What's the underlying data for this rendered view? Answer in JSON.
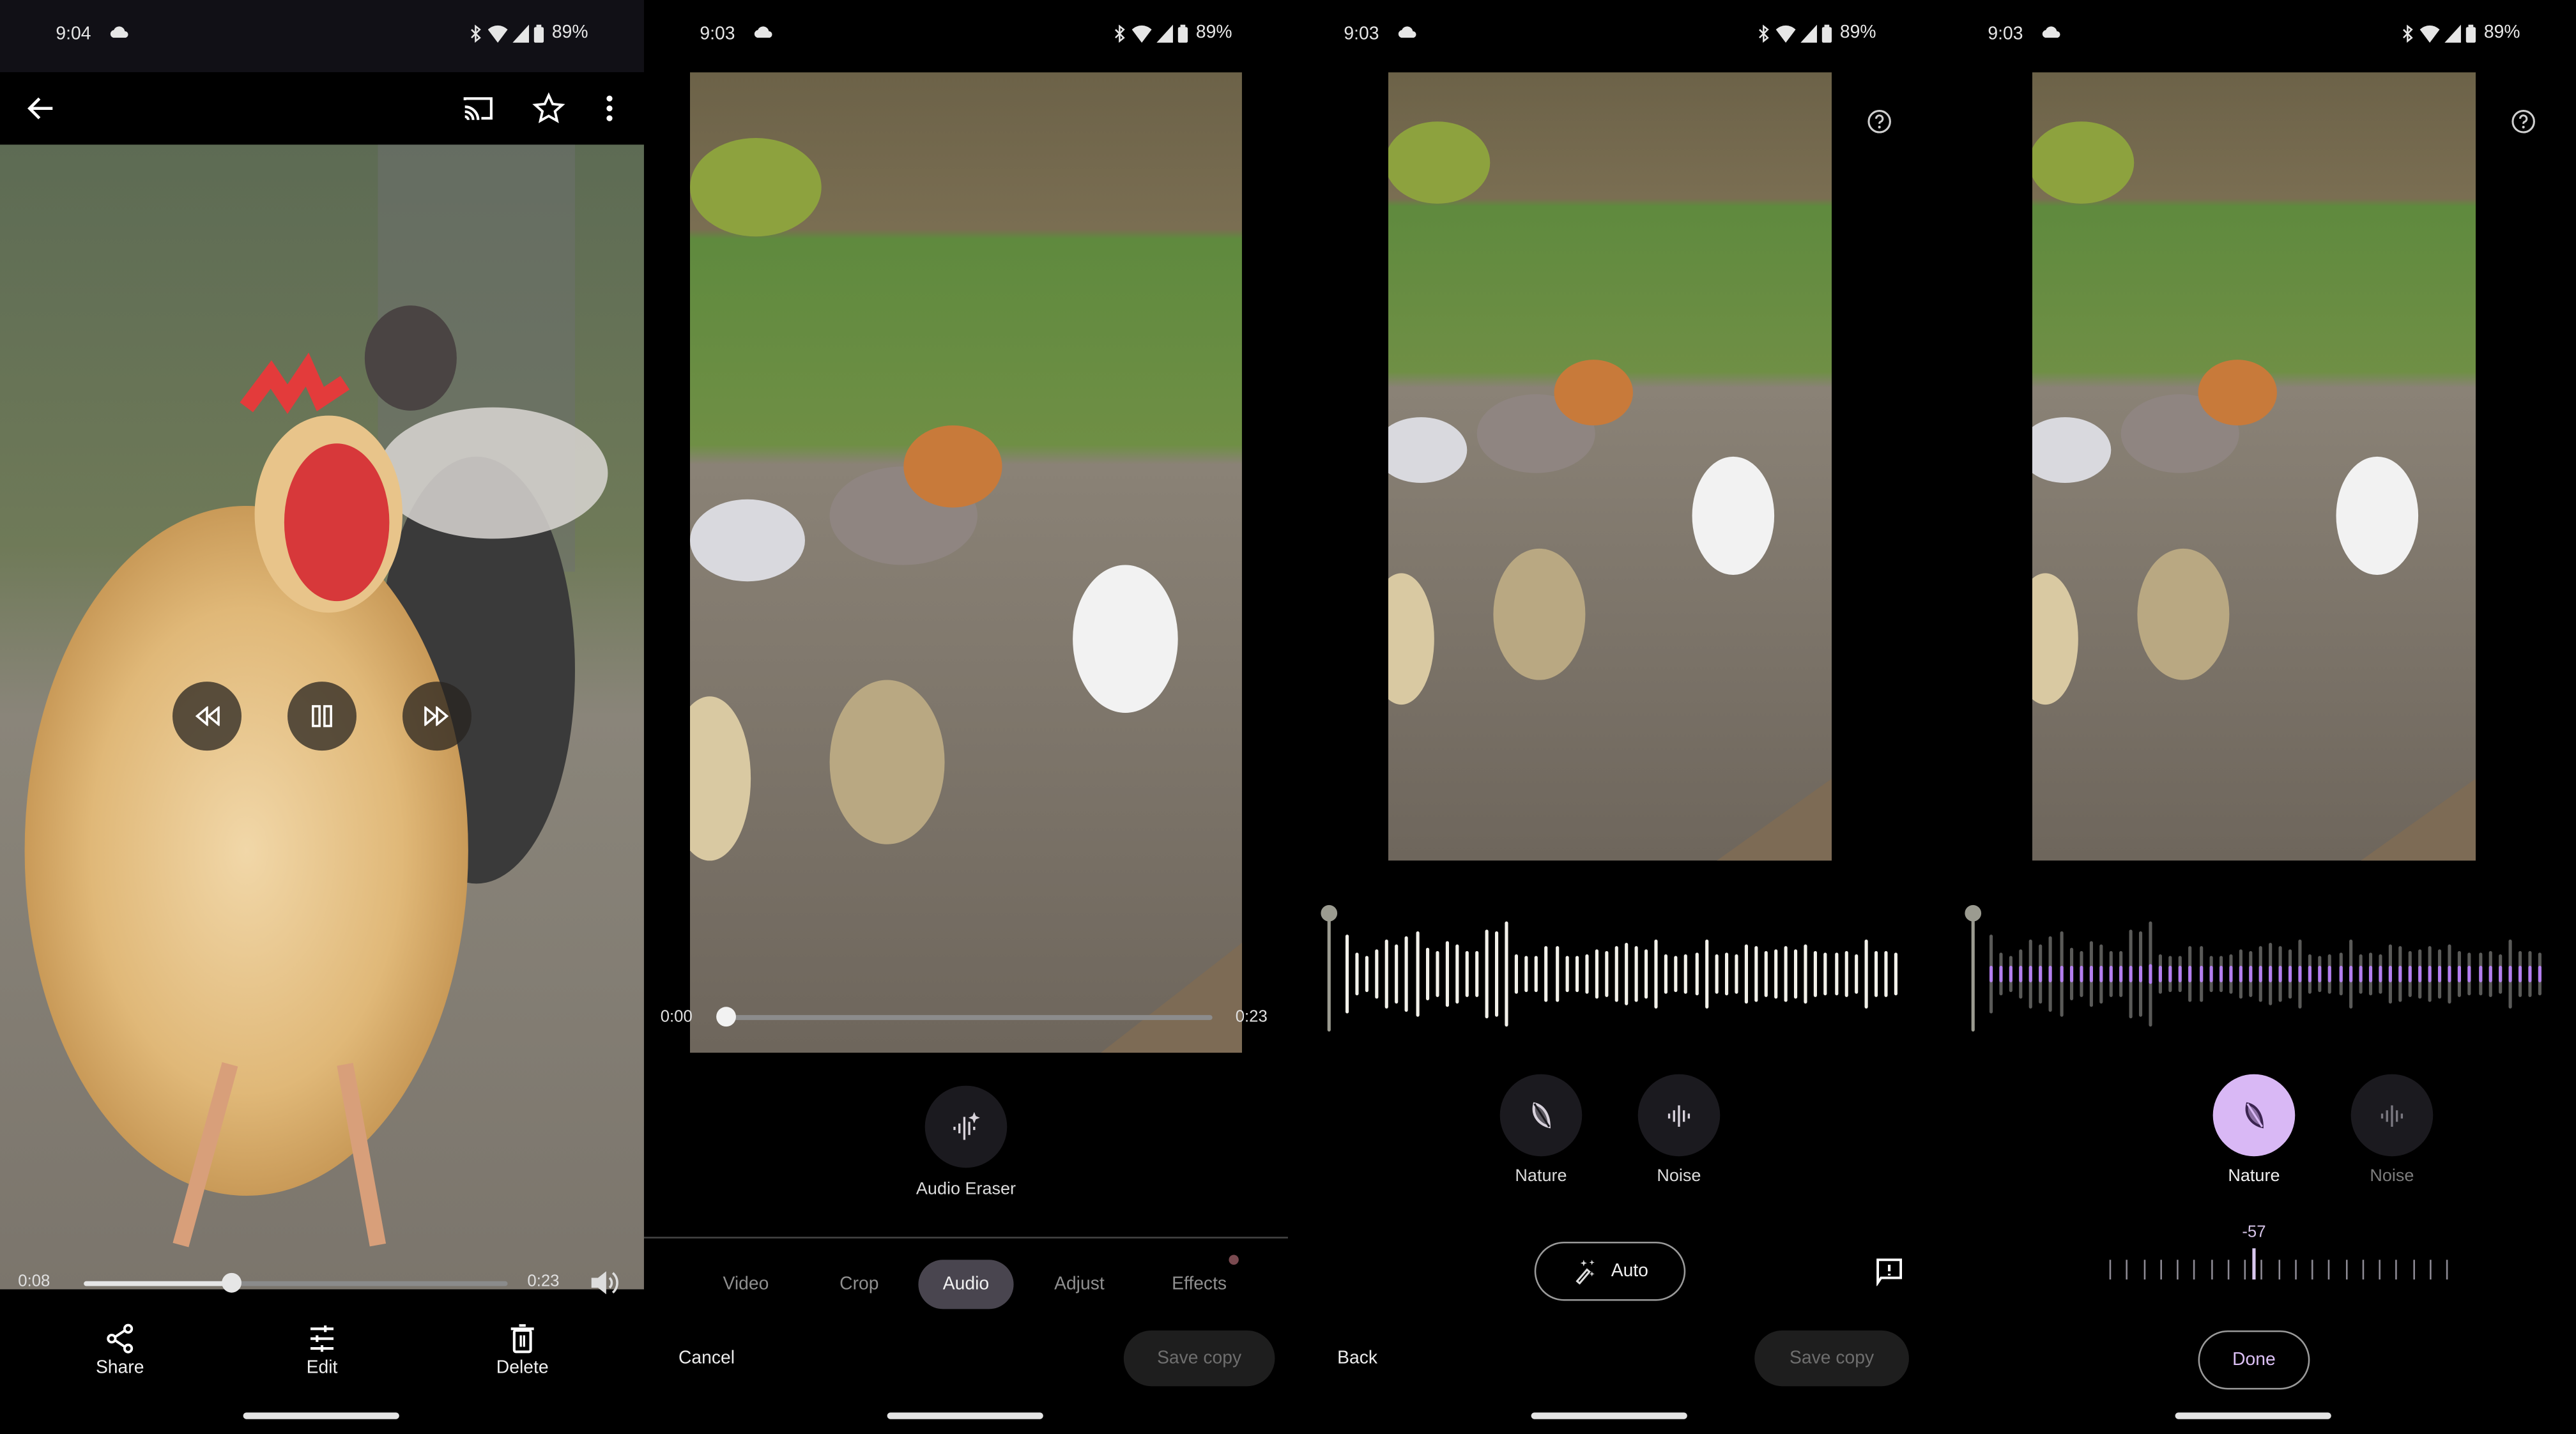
{
  "panels": [
    {
      "status": {
        "time": "9:04",
        "battery": "89%"
      },
      "topbar": {
        "icons": [
          "back-arrow-icon",
          "cast-icon",
          "star-icon",
          "more-vert-icon"
        ]
      },
      "player": {
        "current_time": "0:08",
        "duration": "0:23",
        "progress": 0.35,
        "controls": [
          "rewind-icon",
          "pause-icon",
          "fast-forward-icon"
        ]
      },
      "actions": [
        {
          "label": "Share",
          "icon": "share-icon"
        },
        {
          "label": "Edit",
          "icon": "edit-sliders-icon"
        },
        {
          "label": "Delete",
          "icon": "trash-icon"
        }
      ]
    },
    {
      "status": {
        "time": "9:03",
        "battery": "89%"
      },
      "player": {
        "current_time": "0:00",
        "duration": "0:23",
        "progress": 0.0
      },
      "tool": {
        "label": "Audio Eraser",
        "icon": "audio-eraser-icon"
      },
      "tabs": [
        {
          "label": "Video",
          "active": false
        },
        {
          "label": "Crop",
          "active": false
        },
        {
          "label": "Audio",
          "active": true
        },
        {
          "label": "Adjust",
          "active": false
        },
        {
          "label": "Effects",
          "active": false,
          "badge": true
        }
      ],
      "cancel_label": "Cancel",
      "save_label": "Save copy"
    },
    {
      "status": {
        "time": "9:03",
        "battery": "89%"
      },
      "help_icon": "help-icon",
      "categories": [
        {
          "label": "Nature",
          "icon": "leaf-icon",
          "selected": false
        },
        {
          "label": "Noise",
          "icon": "waveform-icon",
          "selected": false
        }
      ],
      "auto_label": "Auto",
      "back_label": "Back",
      "save_label": "Save copy",
      "feedback_icon": "feedback-icon"
    },
    {
      "status": {
        "time": "9:03",
        "battery": "89%"
      },
      "help_icon": "help-icon",
      "categories": [
        {
          "label": "Nature",
          "icon": "leaf-icon",
          "selected": true
        },
        {
          "label": "Noise",
          "icon": "waveform-icon",
          "selected": false
        }
      ],
      "slider": {
        "value": "-57"
      },
      "done_label": "Done"
    }
  ],
  "waveform": [
    0.62,
    0.35,
    0.28,
    0.4,
    0.55,
    0.48,
    0.6,
    0.68,
    0.42,
    0.38,
    0.52,
    0.48,
    0.36,
    0.38,
    0.7,
    0.68,
    0.84,
    0.32,
    0.3,
    0.3,
    0.46,
    0.44,
    0.3,
    0.3,
    0.32,
    0.4,
    0.36,
    0.44,
    0.5,
    0.44,
    0.4,
    0.56,
    0.32,
    0.3,
    0.32,
    0.34,
    0.56,
    0.32,
    0.34,
    0.32,
    0.48,
    0.46,
    0.36,
    0.4,
    0.44,
    0.4,
    0.48,
    0.38,
    0.34,
    0.34,
    0.36,
    0.32,
    0.56,
    0.36,
    0.36,
    0.34
  ],
  "colors": {
    "accent": "#d9b8f5",
    "accent_dark": "#3b2450",
    "wave_purple": "#b47ff0"
  }
}
